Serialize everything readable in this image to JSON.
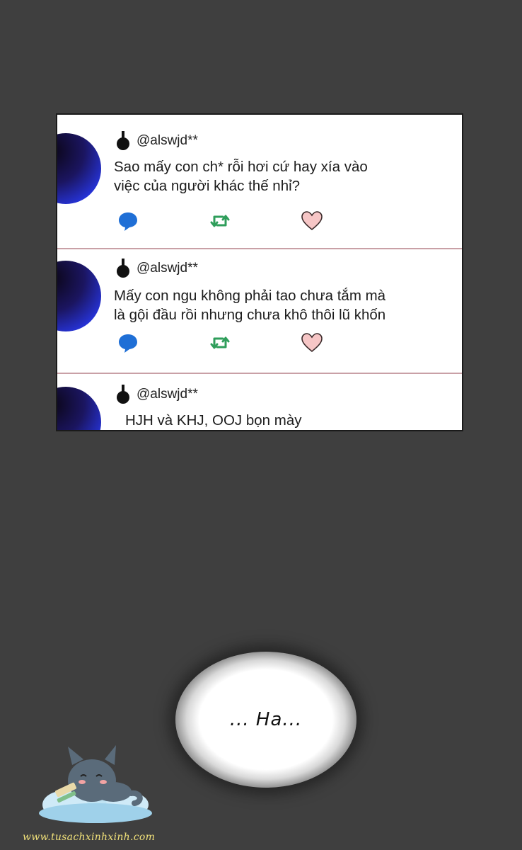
{
  "tweets": [
    {
      "handle": "@alswjd**",
      "text": "Sao mấy con ch* rỗi hơi cứ hay xía vào\nviệc của người khác thế nhỉ?"
    },
    {
      "handle": "@alswjd**",
      "text": "Mấy con ngu không phải tao chưa tắm mà\nlà gội đầu rồi nhưng chưa khô thôi lũ khốn"
    },
    {
      "handle": "@alswjd**",
      "text": "HJH và KHJ, OOJ bọn mày"
    }
  ],
  "icons": {
    "reply": "speech-bubble-icon",
    "retweet": "retweet-icon",
    "like": "heart-icon",
    "pin": "pin-icon"
  },
  "colors": {
    "background": "#3f3f3f",
    "reply": "#1f6fd6",
    "retweet": "#2f9e5b",
    "like_fill": "#f6c6c6",
    "like_stroke": "#3a2a2a",
    "divider": "#c9a0a6",
    "watermark_text": "#f2e27a"
  },
  "bubble": {
    "text": "... Ha..."
  },
  "watermark": {
    "text": "www.tusachxinhxinh.com"
  }
}
